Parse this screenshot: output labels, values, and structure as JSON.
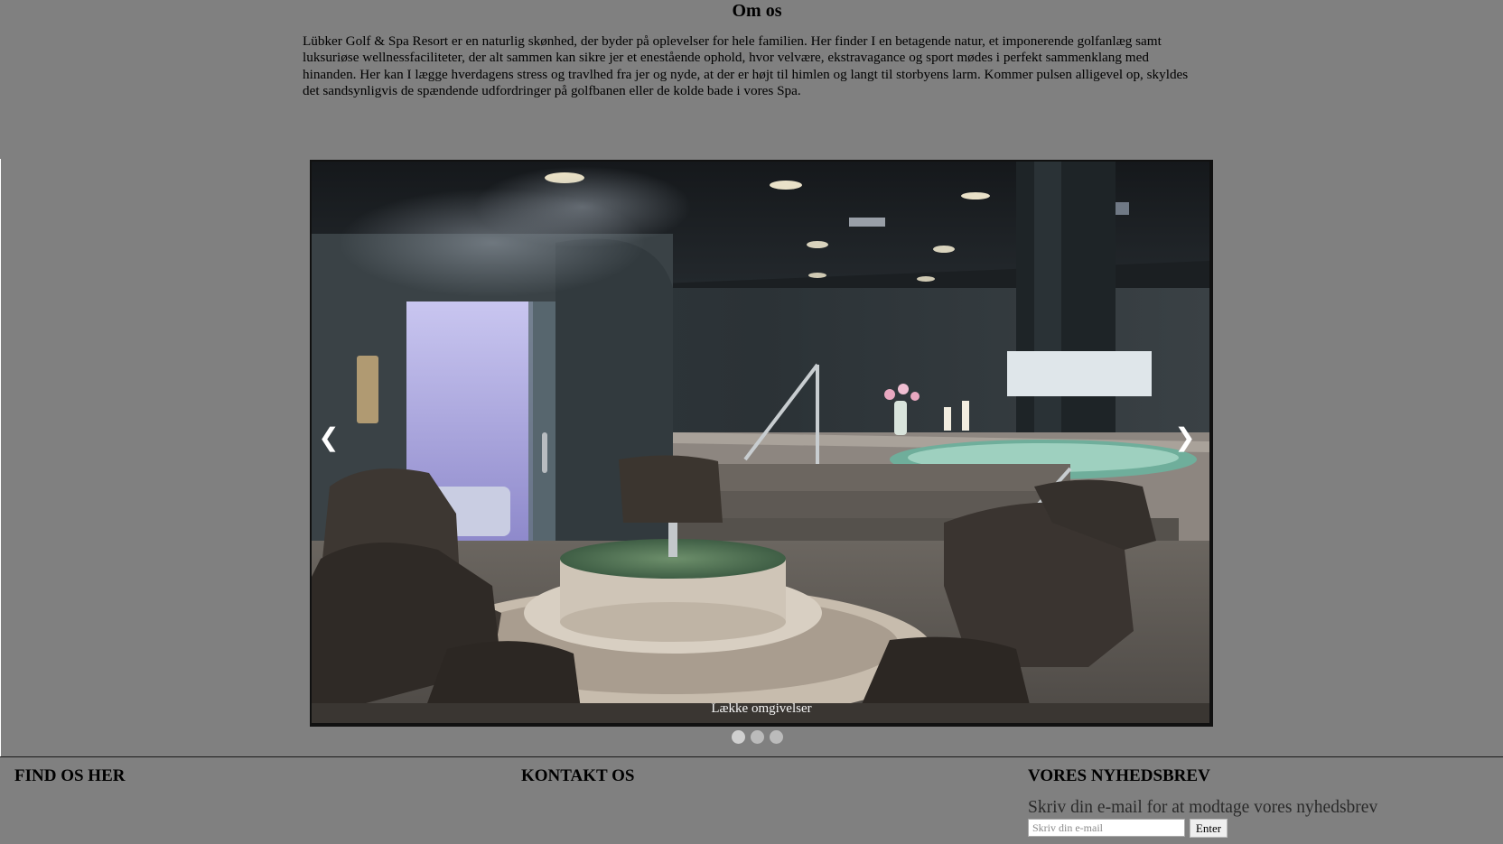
{
  "about": {
    "title": "Om os",
    "text": "Lübker Golf & Spa Resort er en naturlig skønhed, der byder på oplevelser for hele familien. Her finder I en betagende natur, et imponerende golfanlæg samt luksuriøse wellnessfaciliteter, der alt sammen kan sikre jer et enestående ophold, hvor velvære, ekstravagance og sport mødes i perfekt sammenklang med hinanden. Her kan I lægge hverdagens stress og travlhed fra jer og nyde, at der er højt til himlen og langt til storbyens larm. Kommer pulsen alligevel op, skyldes det sandsynligvis de spændende udfordringer på golfbanen eller de kolde bade i vores Spa."
  },
  "slideshow": {
    "prev_label": "❮",
    "next_label": "❯",
    "caption": "Lække omgivelser",
    "dot_count": 3,
    "active_dot": 0
  },
  "footer": {
    "find_heading": "FIND OS HER",
    "contact_heading": "KONTAKT OS",
    "newsletter_heading": "VORES NYHEDSBREV",
    "newsletter_text": "Skriv din e-mail for at modtage vores nyhedsbrev",
    "email_placeholder": "Skriv din e-mail",
    "email_value": "",
    "submit_label": "Enter"
  },
  "colors": {
    "page_background": "#808080",
    "dot": "#bbbbbb"
  }
}
